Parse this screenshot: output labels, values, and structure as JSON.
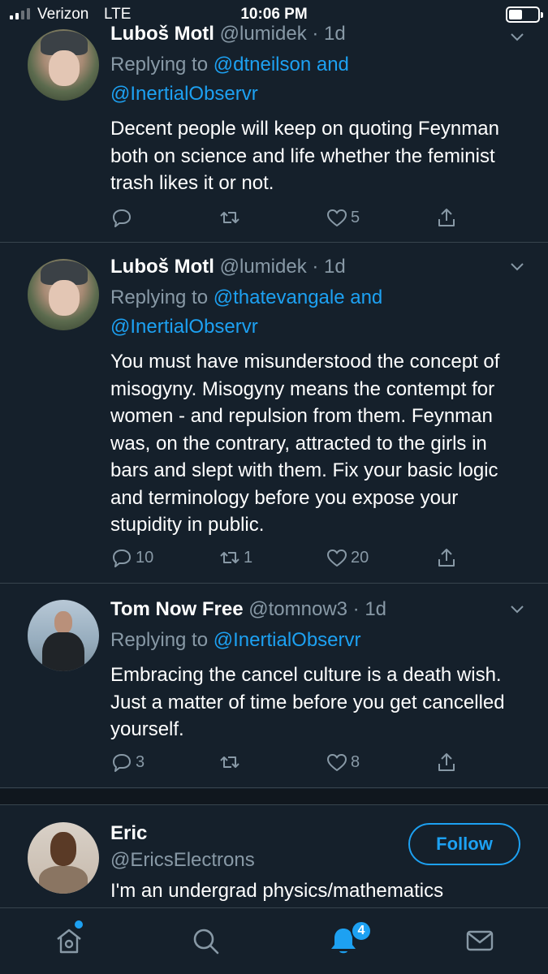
{
  "status_bar": {
    "carrier": "Verizon",
    "network": "LTE",
    "time": "10:06 PM"
  },
  "tweets": [
    {
      "name": "Luboš Motl",
      "handle": "@lumidek",
      "age": "1d",
      "replying_prefix": "Replying to ",
      "mentions": [
        "@dtneilson",
        "@InertialObservr"
      ],
      "joiner": " and",
      "body": "Decent people will keep on quoting Feynman both on science and life whether the feminist trash likes it or not.",
      "replies": "",
      "retweets": "",
      "likes": "5"
    },
    {
      "name": "Luboš Motl",
      "handle": "@lumidek",
      "age": "1d",
      "replying_prefix": "Replying to ",
      "mentions": [
        "@thatevangale",
        "@InertialObservr"
      ],
      "joiner": " and",
      "body": "You must have misunderstood the concept of misogyny. Misogyny means the contempt for women - and repulsion from them. Feynman was, on the contrary, attracted to the girls in bars and slept with them. Fix your basic logic and terminology before you expose your stupidity in public.",
      "replies": "10",
      "retweets": "1",
      "likes": "20"
    },
    {
      "name": "Tom Now Free",
      "handle": "@tomnow3",
      "age": "1d",
      "replying_prefix": "Replying to ",
      "mentions": [
        "@InertialObservr"
      ],
      "joiner": "",
      "body": "Embracing the cancel culture is a death wish. Just a matter of time before you get cancelled yourself.",
      "replies": "3",
      "retweets": "",
      "likes": "8"
    }
  ],
  "suggestion": {
    "name": "Eric",
    "handle": "@EricsElectrons",
    "bio": "I'm an undergrad physics/mathematics",
    "follow_label": "Follow"
  },
  "tab_bar": {
    "notifications_badge": "4",
    "icons": [
      "home-icon",
      "search-icon",
      "bell-icon",
      "mail-icon"
    ]
  },
  "colors": {
    "background": "#15202b",
    "accent": "#1da1f2",
    "muted": "#8899a6",
    "divider": "#38444d"
  }
}
